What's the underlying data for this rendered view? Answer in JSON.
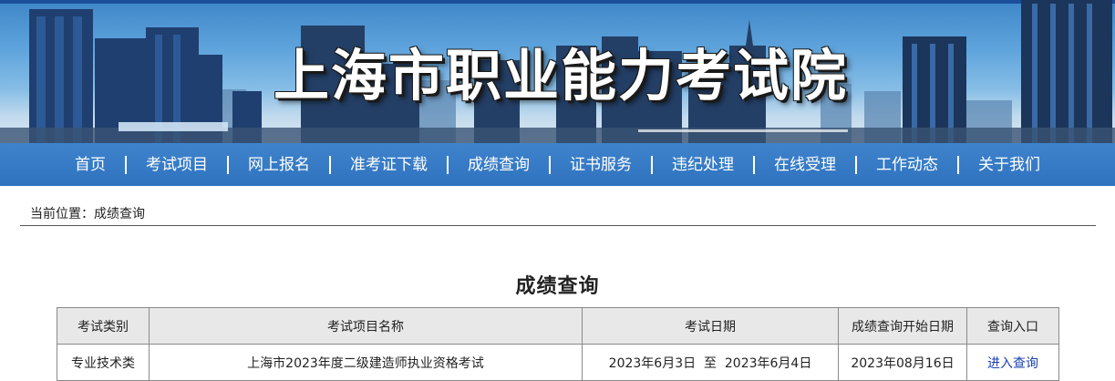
{
  "header": {
    "site_title": "上海市职业能力考试院"
  },
  "nav": {
    "items": [
      "首页",
      "考试项目",
      "网上报名",
      "准考证下载",
      "成绩查询",
      "证书服务",
      "违纪处理",
      "在线受理",
      "工作动态",
      "关于我们"
    ]
  },
  "breadcrumb": {
    "text": "当前位置：成绩查询"
  },
  "main": {
    "title": "成绩查询",
    "table": {
      "headers": [
        "考试类别",
        "考试项目名称",
        "考试日期",
        "成绩查询开始日期",
        "查询入口"
      ],
      "rows": [
        [
          "专业技术类",
          "上海市2023年度二级建造师执业资格考试",
          "2023年6月3日  至  2023年6月4日",
          "2023年08月16日",
          "进入查询"
        ]
      ]
    }
  },
  "colors": {
    "nav_background": "#2f73c0",
    "link": "#1a3fb3",
    "header_cell": "#e8e8e8"
  }
}
